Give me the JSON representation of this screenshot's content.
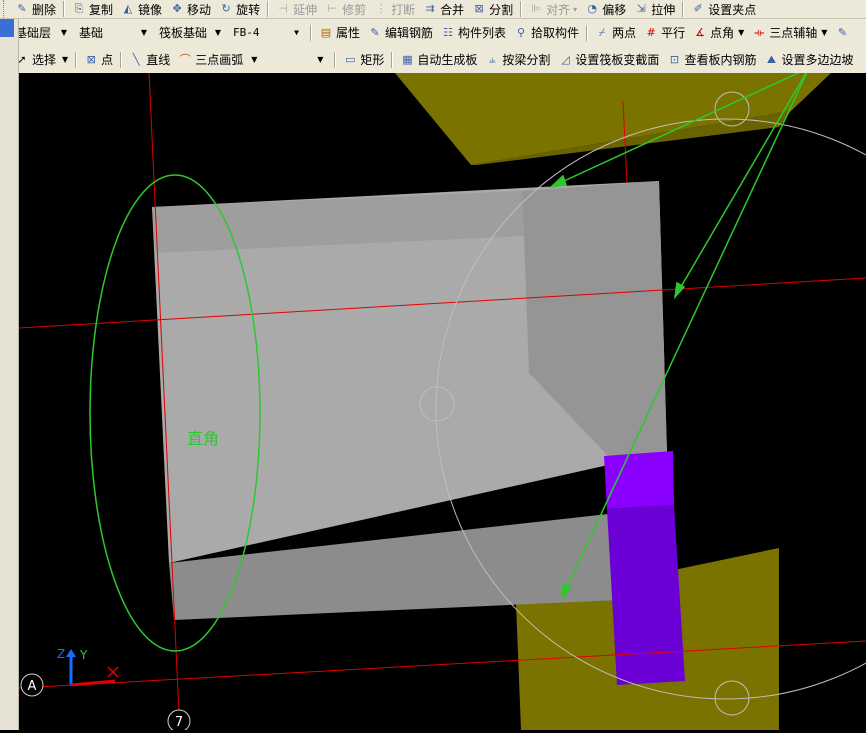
{
  "toolbar1": {
    "delete": "删除",
    "copy": "复制",
    "mirror": "镜像",
    "move": "移动",
    "rotate": "旋转",
    "extend": "延伸",
    "trim": "修剪",
    "break": "打断",
    "merge": "合并",
    "split": "分割",
    "align": "对齐",
    "offset": "偏移",
    "stretch": "拉伸",
    "set_grip": "设置夹点"
  },
  "toolbar2": {
    "layer": "基础层",
    "category": "基础",
    "component_type": "筏板基础",
    "component": "FB-4",
    "properties": "属性",
    "edit_rebar": "编辑钢筋",
    "component_list": "构件列表",
    "pick_component": "拾取构件",
    "two_points": "两点",
    "parallel": "平行",
    "point_angle": "点角",
    "three_point_axis": "三点辅轴"
  },
  "toolbar3": {
    "select": "选择",
    "point": "点",
    "line": "直线",
    "arc": "三点画弧",
    "arc_value": "",
    "rect": "矩形",
    "auto_slab": "自动生成板",
    "split_by_beam": "按梁分割",
    "set_variable_section": "设置筏板变截面",
    "view_slab_rebar": "查看板内钢筋",
    "set_multi_edge_slope": "设置多边边坡"
  },
  "viewport": {
    "annotation": "直角",
    "axis_z": "Z",
    "axis_y": "Y",
    "axis_label_a": "A",
    "axis_label_7": "7",
    "colors": {
      "background": "#000000",
      "slab_top": "#aaaaaa",
      "slab_side": "#8c8c8c",
      "footing": "#7a7300",
      "column": "#7000e6",
      "axis_line": "#e00000",
      "annotation": "#2ec82e"
    }
  }
}
